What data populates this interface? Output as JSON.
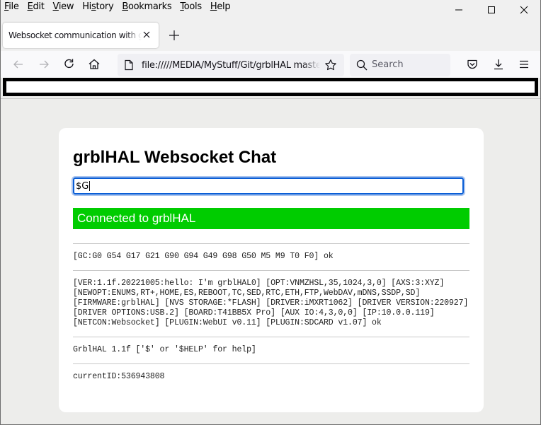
{
  "menubar": {
    "items": [
      {
        "label": "File",
        "accel": "F",
        "rest": "ile"
      },
      {
        "label": "Edit",
        "accel": "E",
        "rest": "dit"
      },
      {
        "label": "View",
        "accel": "V",
        "rest": "iew"
      },
      {
        "label": "History",
        "pre": "Hi",
        "accel": "s",
        "rest": "tory"
      },
      {
        "label": "Bookmarks",
        "accel": "B",
        "rest": "ookmarks"
      },
      {
        "label": "Tools",
        "accel": "T",
        "rest": "ools"
      },
      {
        "label": "Help",
        "accel": "H",
        "rest": "elp"
      }
    ]
  },
  "tab": {
    "title": "Websocket communication with grblHAL"
  },
  "navbar": {
    "url": "file://///MEDIA/MyStuff/Git/grblHAL master",
    "search_placeholder": "Search"
  },
  "page": {
    "title": "grblHAL Websocket Chat",
    "input_value": "$G",
    "status_text": "Connected to grblHAL",
    "status_color": "#00cc00",
    "log": [
      "[GC:G0 G54 G17 G21 G90 G94 G49 G98 G50 M5 M9 T0 F0] ok",
      "[VER:1.1f.20221005:hello: I'm grblHAL0] [OPT:VNMZHSL,35,1024,3,0] [AXS:3:XYZ] [NEWOPT:ENUMS,RT+,HOME,ES,REBOOT,TC,SED,RTC,ETH,FTP,WebDAV,mDNS,SSDP,SD] [FIRMWARE:grblHAL] [NVS STORAGE:*FLASH] [DRIVER:iMXRT1062] [DRIVER VERSION:220927] [DRIVER OPTIONS:USB.2] [BOARD:T41BB5X Pro] [AUX IO:4,3,0,0] [IP:10.0.0.119] [NETCON:Websocket] [PLUGIN:WebUI v0.11] [PLUGIN:SDCARD v1.07] ok",
      "GrblHAL 1.1f ['$' or '$HELP' for help]",
      "currentID:536943808"
    ]
  }
}
